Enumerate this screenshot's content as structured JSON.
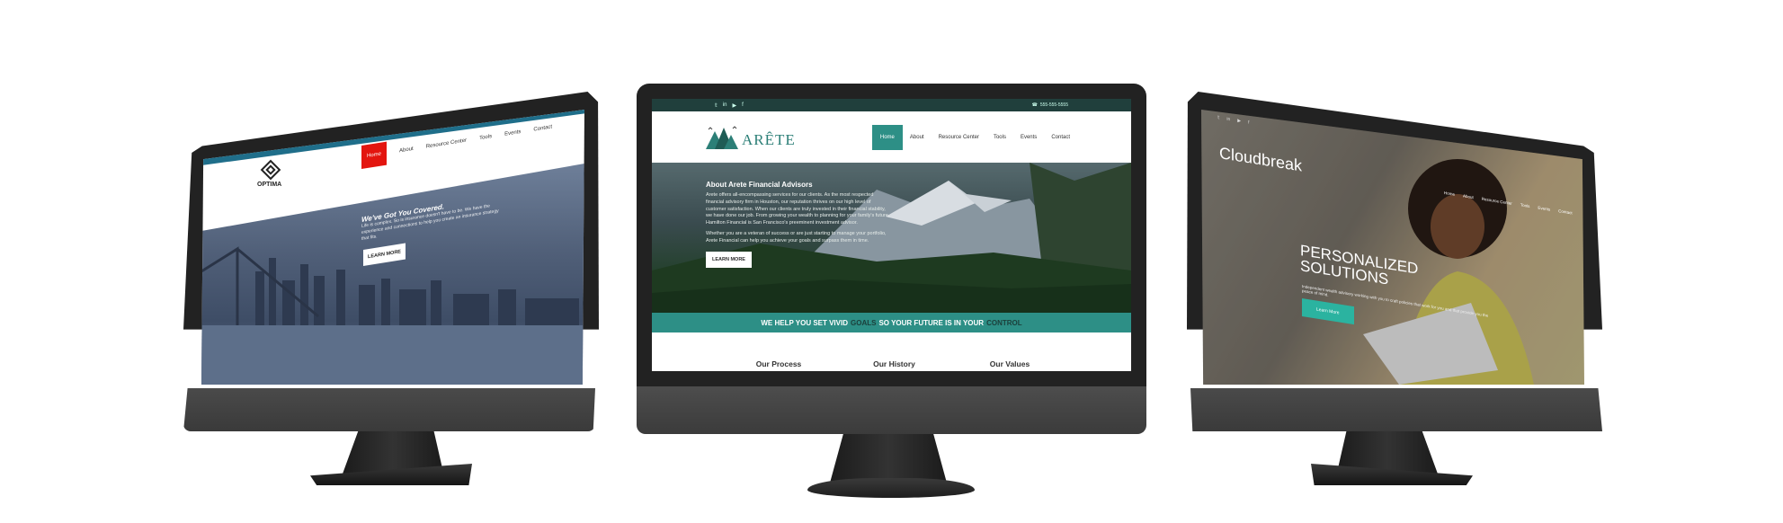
{
  "center": {
    "social_icons": [
      "twitter-icon",
      "linkedin-icon",
      "youtube-icon",
      "facebook-icon"
    ],
    "social_glyphs": [
      "𝕥",
      "in",
      "▶",
      "f"
    ],
    "phone": "555-555-5555",
    "logo_text": "ARÊTE",
    "nav": [
      "Home",
      "About",
      "Resource Center",
      "Tools",
      "Events",
      "Contact"
    ],
    "hero": {
      "title": "About Arete Financial Advisors",
      "p1": "Arete offers all-encompassing services for our clients. As the most respected financial advisory firm in Houston, our reputation thrives on our high level of customer satisfaction. When our clients are truly invested in their financial stability, we have done our job. From growing your wealth to planning for your family's future, Hamilton Financial is San Francisco's preeminent investment advisor.",
      "p2": "Whether you are a veteran of success or are just starting to manage your portfolio, Arete Financial can help you achieve your goals and surpass them in time.",
      "button": "LEARN MORE"
    },
    "band": {
      "part1": "WE HELP YOU SET VIVID",
      "goals": "GOALS",
      "part2": "SO YOUR FUTURE IS IN YOUR",
      "control": "CONTROL"
    },
    "columns": [
      "Our Process",
      "Our History",
      "Our Values"
    ],
    "colors": {
      "teal": "#2d8f86",
      "dark_teal": "#203f3c"
    }
  },
  "left": {
    "logo_text": "OPTIMA",
    "nav": [
      "Home",
      "About",
      "Resource Center",
      "Tools",
      "Events",
      "Contact"
    ],
    "hero": {
      "title": "We've Got You Covered.",
      "text": "Life is complex. So is insurance doesn't have to be. We have the experience and connections to help you create an insurance strategy that fits.",
      "button": "LEARN MORE"
    },
    "colors": {
      "accent": "#e3150f",
      "stripe": "#1f6e8a"
    }
  },
  "right": {
    "brand": "Cloudbreak",
    "nav": [
      "Home",
      "About",
      "Resource Center",
      "Tools",
      "Events",
      "Contact"
    ],
    "title_line1": "PERSONALIZED",
    "title_line2": "SOLUTIONS",
    "subtitle": "Independent wealth advisory working with you to craft policies that work for you and that provide you the peace of mind.",
    "button": "Learn More",
    "colors": {
      "accent": "#2bb3a0"
    }
  }
}
